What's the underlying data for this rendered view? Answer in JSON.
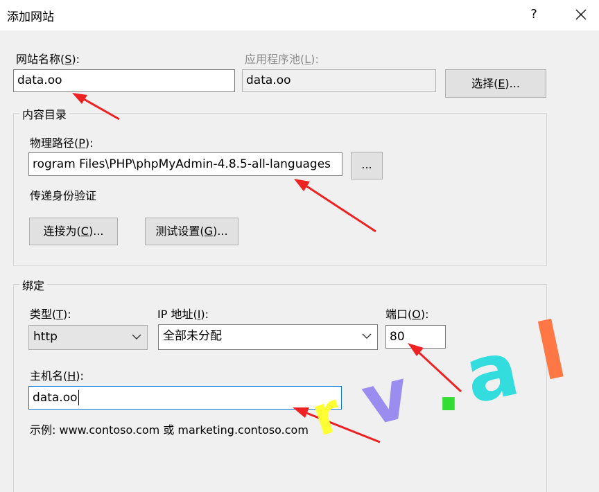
{
  "window": {
    "title": "添加网站",
    "help_glyph": "?"
  },
  "site_name": {
    "label_pre": "网站名称(",
    "label_key": "S",
    "label_post": "):",
    "value": "data.oo"
  },
  "app_pool": {
    "label_pre": "应用程序池(",
    "label_key": "L",
    "label_post": "):",
    "value": "data.oo",
    "select_pre": "选择(",
    "select_key": "E",
    "select_post": ")..."
  },
  "content_dir": {
    "group_title": "内容目录",
    "path_label_pre": "物理路径(",
    "path_label_key": "P",
    "path_label_post": "):",
    "path_value": "rogram Files\\PHP\\phpMyAdmin-4.8.5-all-languages",
    "browse_label": "...",
    "auth_label": "传递身份验证",
    "connect_pre": "连接为(",
    "connect_key": "C",
    "connect_post": ")...",
    "test_pre": "测试设置(",
    "test_key": "G",
    "test_post": ")..."
  },
  "binding": {
    "group_title": "绑定",
    "type_label_pre": "类型(",
    "type_label_key": "T",
    "type_label_post": "):",
    "type_value": "http",
    "ip_label_pre": "IP 地址(",
    "ip_label_key": "I",
    "ip_label_post": "):",
    "ip_value": "全部未分配",
    "port_label_pre": "端口(",
    "port_label_key": "O",
    "port_label_post": "):",
    "port_value": "80",
    "host_label_pre": "主机名(",
    "host_label_key": "H",
    "host_label_post": "):",
    "host_value": "data.oo",
    "example": "示例: www.contoso.com 或 marketing.contoso.com"
  },
  "watermark": {
    "letters": [
      "r",
      "v",
      ".",
      "a",
      "l"
    ],
    "colors": [
      "#ffff33",
      "#9b8cf0",
      "#33dd33",
      "#33dddd",
      "#ff7744"
    ]
  },
  "colors": {
    "annotation_arrow": "#ee2222",
    "focus_border": "#0078d7"
  }
}
